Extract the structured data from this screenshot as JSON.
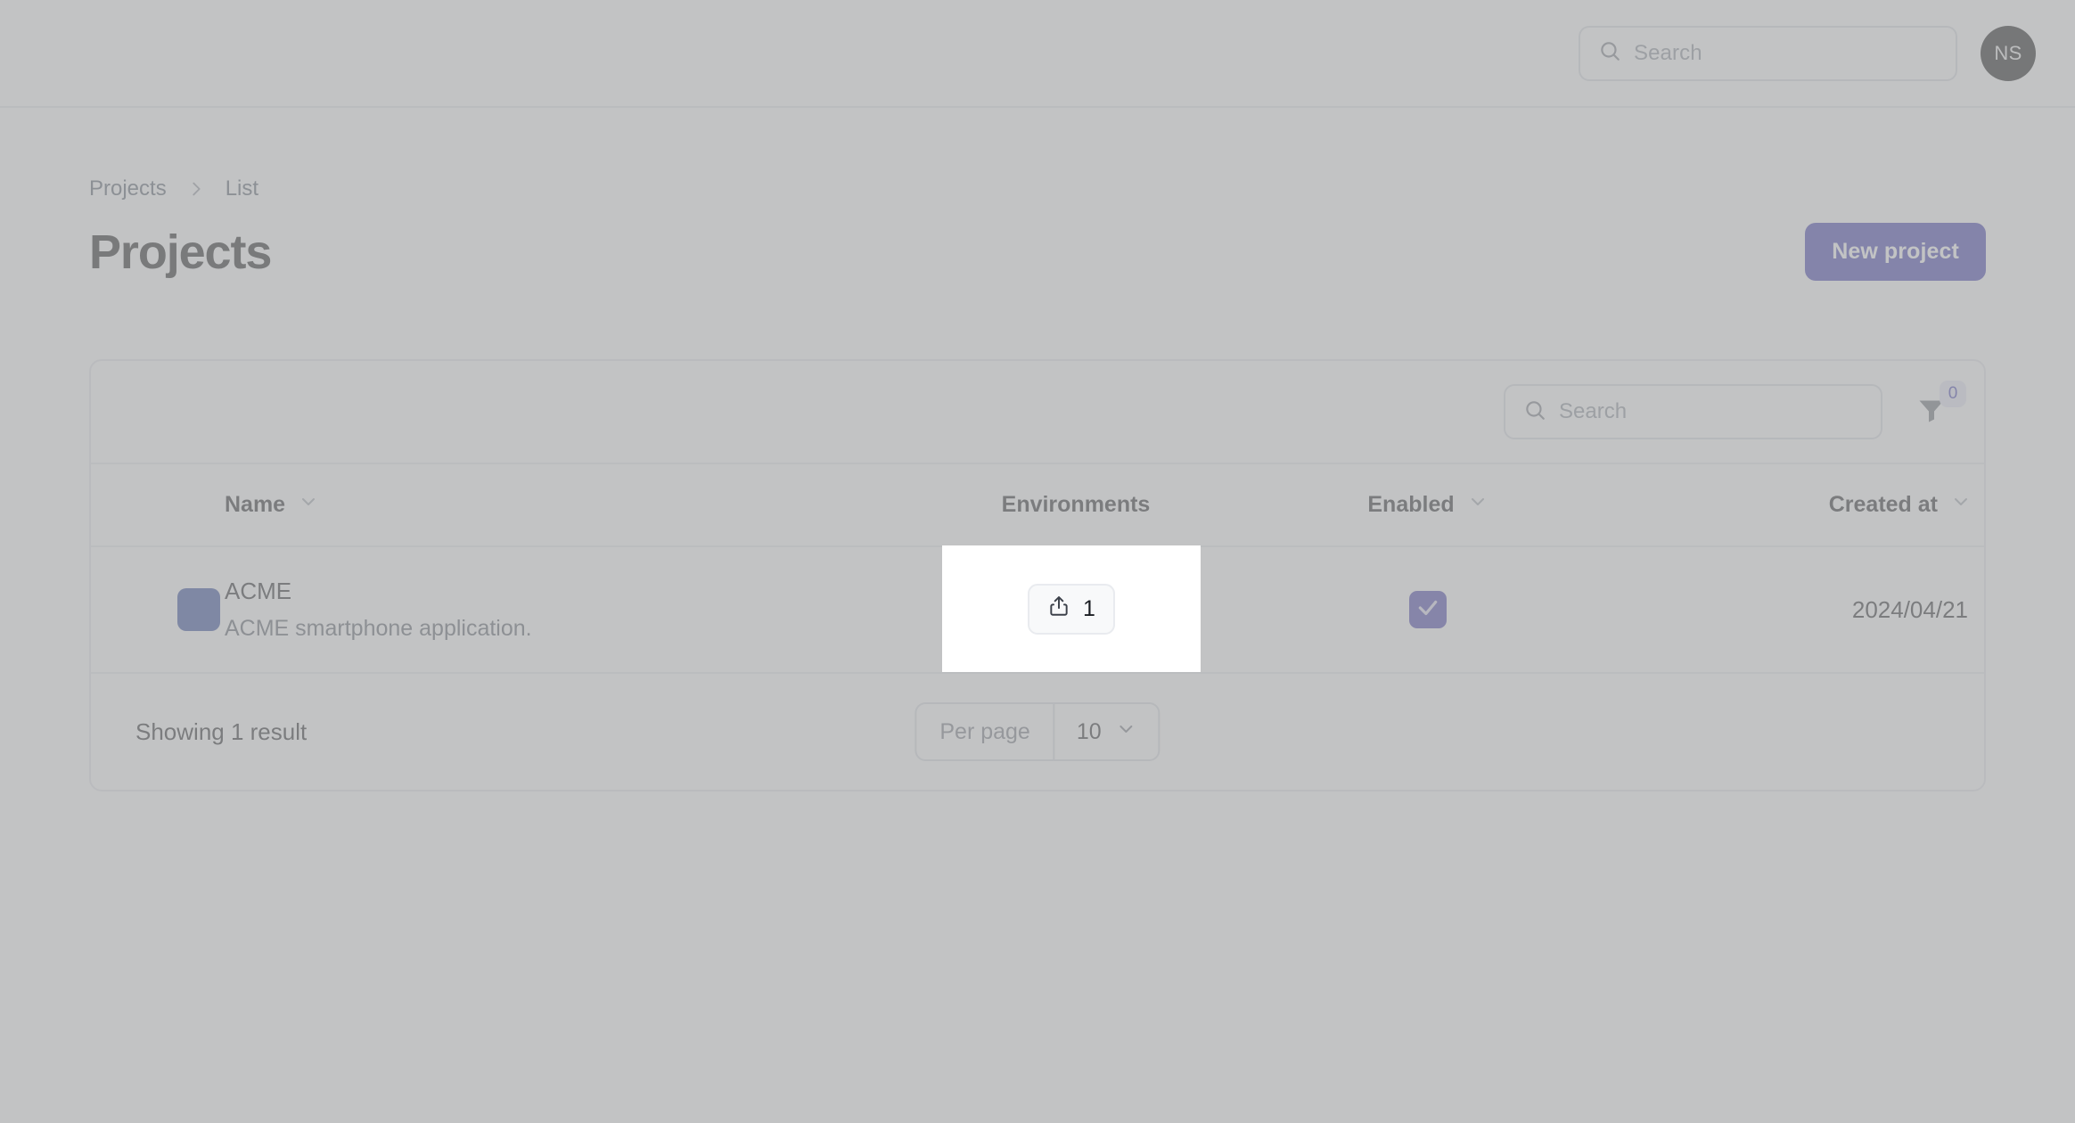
{
  "topbar": {
    "search": {
      "placeholder": "Search",
      "value": "",
      "icon": "search-icon"
    },
    "avatar": {
      "initials": "NS",
      "bg": "#000000"
    }
  },
  "breadcrumb": {
    "items": [
      {
        "label": "Projects"
      },
      {
        "label": "List"
      }
    ],
    "separator_icon": "chevron-right-icon"
  },
  "header": {
    "title": "Projects",
    "new_project_label": "New project",
    "accent": "#312ea8"
  },
  "card": {
    "toolbar": {
      "search": {
        "placeholder": "Search",
        "value": "",
        "icon": "search-icon"
      },
      "filter": {
        "icon": "filter-funnel-icon",
        "badge": "0",
        "badge_color": "#312ea8"
      }
    },
    "table": {
      "columns": [
        {
          "key": "swatch",
          "label": "",
          "sortable": false
        },
        {
          "key": "name",
          "label": "Name",
          "sortable": true
        },
        {
          "key": "environments",
          "label": "Environments",
          "sortable": false
        },
        {
          "key": "enabled",
          "label": "Enabled",
          "sortable": true
        },
        {
          "key": "created_at",
          "label": "Created at",
          "sortable": true
        },
        {
          "key": "actions",
          "label": "",
          "sortable": false
        }
      ],
      "sort_icon": "chevron-down-icon",
      "rows": [
        {
          "swatch_color": "#1f3a93",
          "name": "ACME",
          "description": "ACME smartphone application.",
          "environments_count": "1",
          "environments_icon": "share-export-icon",
          "enabled": true,
          "enabled_icon": "check-icon",
          "created_at": "2024/04/21",
          "edit_icon": "edit-pencil-square-icon",
          "edit_color": "#2b36c4",
          "delete_icon": "trash-icon",
          "delete_color": "#b3201f"
        }
      ]
    },
    "footer": {
      "showing": "Showing 1 result",
      "per_page_label": "Per page",
      "per_page_value": "10",
      "per_page_icon": "chevron-down-icon"
    }
  }
}
